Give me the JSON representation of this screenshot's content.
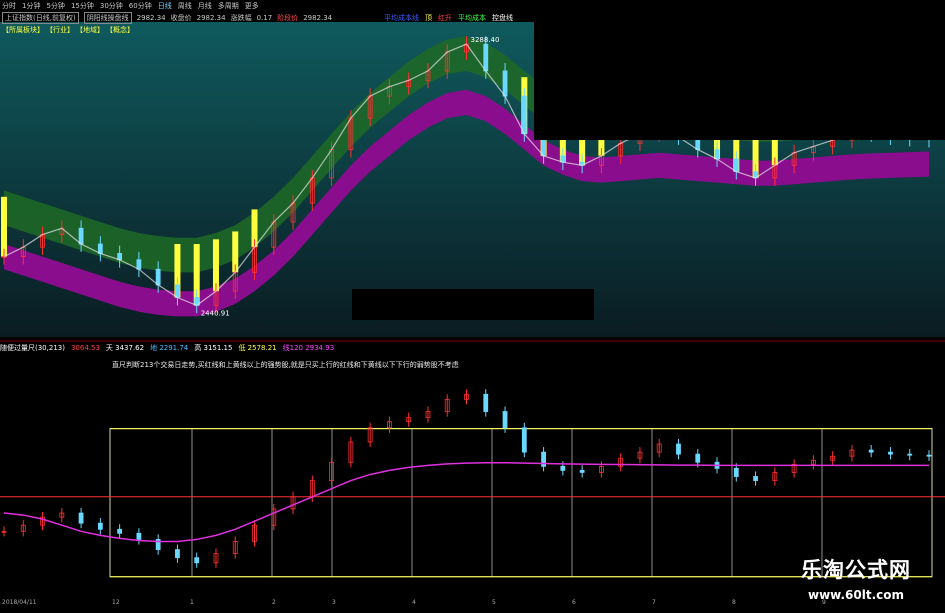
{
  "toolbar": {
    "items": [
      "分时",
      "1分钟",
      "5分钟",
      "15分钟",
      "30分钟",
      "60分钟",
      "日线",
      "周线",
      "月线",
      "多周期",
      "更多"
    ],
    "active": "日线"
  },
  "info": {
    "index_name": "上证指数(日线,前复权)",
    "indicator": "阴阳线操盘线",
    "price1": "2982.34",
    "close_label": "收盘价",
    "close_value": "2982.34",
    "change_label": "涨跌幅",
    "change_value": "0.17",
    "extra_label": "阶段价",
    "extra_value": "2982.34"
  },
  "tags": [
    "【所属板块】",
    "【行业】",
    "【地域】",
    "【概念】"
  ],
  "legend_top": [
    {
      "text": "平均成本线",
      "color": "#3a5cff"
    },
    {
      "text": "顶",
      "color": "#ffff40"
    },
    {
      "text": "红升",
      "color": "#ff4040"
    },
    {
      "text": "平均成本",
      "color": "#40ff40"
    },
    {
      "text": "控盘线",
      "color": "#ffffff"
    }
  ],
  "panel2": {
    "title": "随便过量尺(30,213)",
    "vals": [
      {
        "text": "3064.53",
        "color": "#ff4040"
      },
      {
        "text": "天 3437.62",
        "color": "#ffffff"
      },
      {
        "text": "地 2291.74",
        "color": "#40c0ff"
      },
      {
        "text": "高 3151.15",
        "color": "#ffffff"
      },
      {
        "text": "低 2578.21",
        "color": "#ffff40"
      },
      {
        "text": "线120 2934.93",
        "color": "#ff40ff"
      }
    ],
    "description": "直尺判断213个交易日走势,买红线和上黄线以上的强势股,就是只买上行的红线和下黄线以下下行的弱势股不考虑"
  },
  "watermark": {
    "title": "乐淘公式网",
    "url": "www.60lt.com"
  },
  "dates": [
    "2018/04/11",
    "12",
    "1",
    "2",
    "3",
    "4",
    "5",
    "6",
    "7",
    "8",
    "9"
  ],
  "colors": {
    "bg_top": "#0d3a40",
    "bg_bottom": "#000000",
    "purple_band": "#8a0d8e",
    "green_band": "#1e6a26",
    "yellow_bar": "#ffff40",
    "up_candle": "#ff3030",
    "down_candle": "#6ad8ff",
    "blue_line": "#3050ff"
  },
  "chart_data": [
    {
      "type": "line",
      "title": "上证指数 日线",
      "annotations": [
        {
          "text": "3288.40",
          "role": "high"
        },
        {
          "text": "2440.91",
          "role": "low"
        }
      ],
      "x": [
        0,
        5,
        10,
        15,
        20,
        25,
        30,
        35,
        40,
        45,
        50,
        55,
        60,
        65,
        70,
        75,
        80,
        85,
        90,
        95,
        100,
        105,
        110,
        115,
        120,
        125,
        130,
        135,
        140,
        145,
        150,
        155,
        160,
        165,
        170,
        175,
        180,
        185,
        190,
        195,
        200,
        205,
        210,
        215,
        220,
        225,
        230,
        235,
        240
      ],
      "close": [
        2610,
        2640,
        2680,
        2700,
        2650,
        2620,
        2600,
        2570,
        2520,
        2480,
        2455,
        2500,
        2560,
        2640,
        2720,
        2780,
        2860,
        2950,
        3050,
        3120,
        3150,
        3170,
        3200,
        3260,
        3285,
        3200,
        3120,
        3000,
        2930,
        2910,
        2900,
        2930,
        2970,
        3000,
        3040,
        2990,
        2950,
        2920,
        2880,
        2860,
        2900,
        2940,
        2960,
        2980,
        3010,
        3000,
        2990,
        2985,
        2982
      ],
      "series": [
        {
          "name": "平均成本线",
          "values": [
            2680,
            2660,
            2640,
            2620,
            2600,
            2580,
            2560,
            2545,
            2535,
            2530,
            2530,
            2545,
            2570,
            2610,
            2660,
            2720,
            2790,
            2860,
            2930,
            2990,
            3040,
            3090,
            3130,
            3160,
            3170,
            3150,
            3110,
            3060,
            3010,
            2980,
            2960,
            2955,
            2960,
            2965,
            2970,
            2965,
            2960,
            2955,
            2950,
            2945,
            2945,
            2950,
            2955,
            2960,
            2965,
            2968,
            2970,
            2972,
            2974
          ]
        }
      ]
    },
    {
      "type": "line",
      "title": "随便过量尺(30,213)",
      "series": [
        {
          "name": "线120",
          "values": [
            2700,
            2690,
            2670,
            2640,
            2610,
            2590,
            2575,
            2565,
            2560,
            2560,
            2570,
            2590,
            2620,
            2660,
            2700,
            2740,
            2780,
            2820,
            2860,
            2890,
            2910,
            2925,
            2935,
            2942,
            2946,
            2948,
            2948,
            2946,
            2944,
            2942,
            2941,
            2940,
            2939,
            2938,
            2937,
            2936,
            2936,
            2935,
            2935,
            2935,
            2935,
            2935,
            2935,
            2935,
            2935,
            2935,
            2935,
            2935,
            2935
          ]
        }
      ],
      "levels": {
        "天": 3437.62,
        "地": 2291.74,
        "高": 3151.15,
        "低": 2578.21
      }
    }
  ]
}
